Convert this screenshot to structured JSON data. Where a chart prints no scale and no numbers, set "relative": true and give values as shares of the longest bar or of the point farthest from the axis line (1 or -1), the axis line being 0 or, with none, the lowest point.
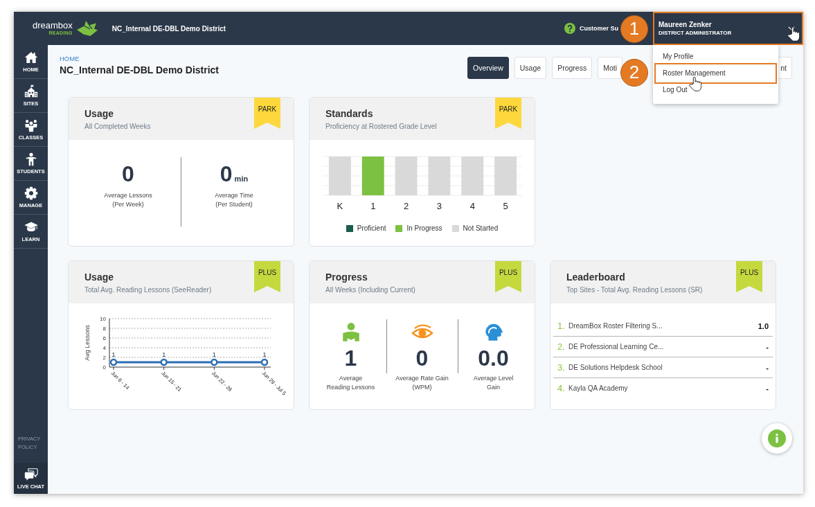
{
  "top_bar": {
    "logo": {
      "wordmark": "dreambox",
      "product": "READING"
    },
    "title": "NC_Internal DE-DBL Demo District",
    "help_link": "Customer Su",
    "user_menu": {
      "name": "Maureen Zenker",
      "role": "DISTRICT ADMINISTRATOR",
      "highlighted": true,
      "callout": "1",
      "expanded": true,
      "items": [
        {
          "label": "My Profile",
          "highlighted": false
        },
        {
          "label": "Roster Management",
          "highlighted": true,
          "callout": "2"
        },
        {
          "label": "Log Out",
          "highlighted": false
        }
      ]
    }
  },
  "sidebar": {
    "items": [
      {
        "label": "HOME"
      },
      {
        "label": "SITES"
      },
      {
        "label": "CLASSES"
      },
      {
        "label": "STUDENTS"
      },
      {
        "label": "MANAGE"
      },
      {
        "label": "LEARN"
      }
    ],
    "privacy_link": "PRIVACY POLICY",
    "live_chat": "LIVE CHAT"
  },
  "page_header": {
    "breadcrumb": "HOME",
    "title": "NC_Internal DE-DBL Demo District",
    "tabs": [
      {
        "label": "Overview",
        "selected": true
      },
      {
        "label": "Usage",
        "selected": false
      },
      {
        "label": "Progress",
        "selected": false
      },
      {
        "label": "Moti",
        "selected": false
      },
      {
        "label": "nt",
        "selected": false
      }
    ]
  },
  "card_rows": [
    [
      {
        "kind": "stats",
        "title": "Usage",
        "subtitle": "All Completed Weeks",
        "tag": {
          "label": "PARK",
          "color": "#fdd83c"
        },
        "stats": [
          {
            "value": "0",
            "label": "Average Lessons\n(Per Week)"
          },
          {
            "value": "0",
            "unit": "min",
            "label": "Average Time\n(Per Student)"
          }
        ]
      },
      {
        "kind": "chart",
        "title": "Standards",
        "subtitle": "Proficiency at Rostered Grade Level",
        "tag": {
          "label": "PARK",
          "color": "#fdd83c"
        },
        "chart_data": {
          "type": "bar",
          "categories": [
            "K",
            "1",
            "2",
            "3",
            "4",
            "5"
          ],
          "series": [
            {
              "name": "Proficient",
              "color": "#1c5c4c",
              "values": [
                0,
                0,
                0,
                0,
                0,
                0
              ]
            },
            {
              "name": "In Progress",
              "color": "#7cc142",
              "values": [
                0,
                1,
                0,
                0,
                0,
                0
              ]
            },
            {
              "name": "Not Started",
              "color": "#d9d9d9",
              "values": [
                1,
                0,
                1,
                1,
                1,
                1
              ]
            }
          ],
          "stacked": true,
          "relative": true,
          "grid": true,
          "legend": "bottom"
        }
      }
    ],
    [
      {
        "kind": "chart",
        "title": "Usage",
        "subtitle": "Total Avg. Reading Lessons (SeeReader)",
        "tag": {
          "label": "PLUS",
          "color": "#c5d93e"
        },
        "chart_data": {
          "type": "line",
          "categories": [
            "Jun 8 - 14",
            "Jun 15 - 21",
            "Jun 22 - 28",
            "Jun 29 - Jul 5"
          ],
          "values": [
            1,
            1,
            1,
            1
          ],
          "ylabel": "Avg Lessons",
          "ylim": [
            0,
            10
          ],
          "yticks": [
            0,
            2,
            4,
            6,
            8,
            10
          ],
          "data_labels": true,
          "grid": true,
          "marker": "circle"
        }
      },
      {
        "kind": "icon_stats",
        "title": "Progress",
        "subtitle": "All Weeks (Including Current)",
        "tag": {
          "label": "PLUS",
          "color": "#c5d93e"
        },
        "stats": [
          {
            "value": "1",
            "label": "Average\nReading Lessons",
            "color": "#7cc142"
          },
          {
            "value": "0",
            "label": "Average Rate Gain\n(WPM)",
            "color": "#f7941d"
          },
          {
            "value": "0.0",
            "label": "Average Level\nGain",
            "color": "#2b8fd6"
          }
        ]
      },
      {
        "kind": "leaderboard",
        "title": "Leaderboard",
        "subtitle": "Top Sites - Total Avg. Reading Lessons (SR)",
        "tag": {
          "label": "PLUS",
          "color": "#c5d93e"
        },
        "rows": [
          {
            "rank": "1.",
            "name": "DreamBox Roster Filtering S...",
            "value": "1.0"
          },
          {
            "rank": "2.",
            "name": "DE Professional Learning Ce...",
            "value": "-"
          },
          {
            "rank": "3.",
            "name": "DE Solutions Helpdesk School",
            "value": "-"
          },
          {
            "rank": "4.",
            "name": "Kayla QA Academy",
            "value": "-"
          }
        ]
      }
    ]
  ]
}
